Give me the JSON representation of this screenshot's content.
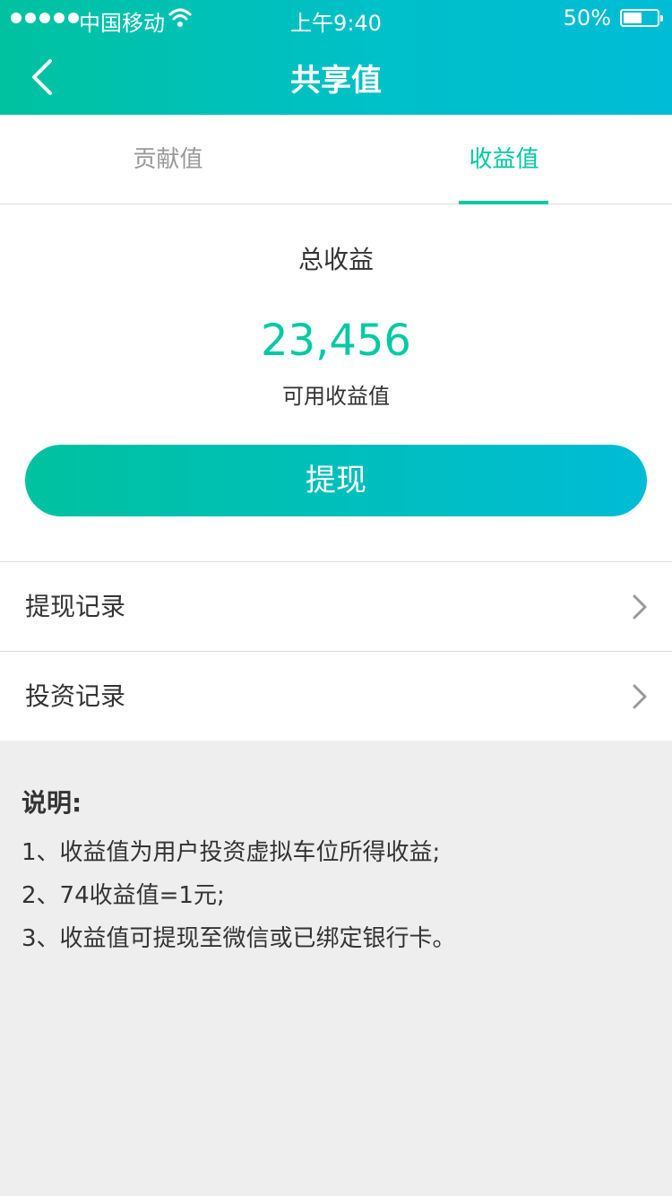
{
  "status_bar": {
    "carrier": "中国移动",
    "time": "上午9:40",
    "battery": "50%"
  },
  "nav": {
    "title": "共享值"
  },
  "tabs": [
    {
      "label": "贡献值"
    },
    {
      "label": "收益值"
    }
  ],
  "summary": {
    "total_label": "总收益",
    "total_value": "23,456",
    "available_label": "可用收益值",
    "withdraw_label": "提现"
  },
  "records": [
    {
      "label": "提现记录"
    },
    {
      "label": "投资记录"
    }
  ],
  "notes": {
    "title": "说明:",
    "items": [
      "1、收益值为用户投资虚拟车位所得收益;",
      "2、74收益值=1元;",
      "3、收益值可提现至微信或已绑定银行卡。"
    ]
  },
  "colors": {
    "accent": "#00caa3",
    "text": "#333333",
    "muted": "#999999",
    "divider": "#dddddd",
    "background": "#eeeeee"
  }
}
